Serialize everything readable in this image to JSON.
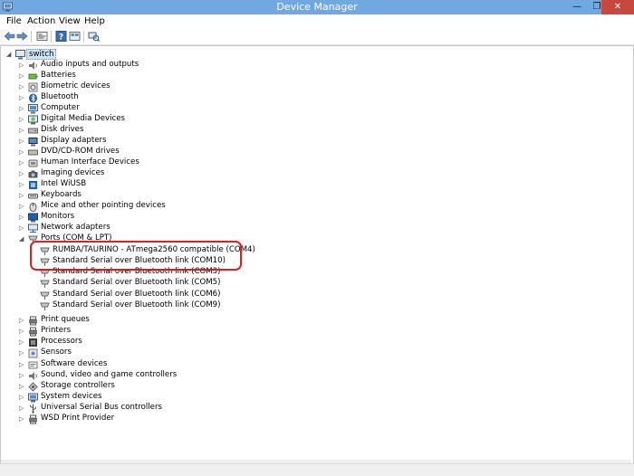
{
  "window": {
    "title": "Device Manager",
    "minimize_glyph": "—",
    "maximize_glyph": "❐",
    "close_glyph": "✕"
  },
  "menu": [
    "File",
    "Action",
    "View",
    "Help"
  ],
  "toolbar_icons": [
    "back-arrow-icon",
    "forward-arrow-icon",
    "properties-icon",
    "help-icon",
    "view-icon",
    "scan-hardware-icon"
  ],
  "tree": {
    "root": "switch",
    "categories_top": [
      {
        "label": "Audio inputs and outputs",
        "icon": "speaker-icon"
      },
      {
        "label": "Batteries",
        "icon": "battery-icon"
      },
      {
        "label": "Biometric devices",
        "icon": "biometric-icon"
      },
      {
        "label": "Bluetooth",
        "icon": "bluetooth-icon"
      },
      {
        "label": "Computer",
        "icon": "computer-icon"
      },
      {
        "label": "Digital Media Devices",
        "icon": "media-device-icon"
      },
      {
        "label": "Disk drives",
        "icon": "disk-drive-icon"
      },
      {
        "label": "Display adapters",
        "icon": "display-adapter-icon"
      },
      {
        "label": "DVD/CD-ROM drives",
        "icon": "dvd-drive-icon"
      },
      {
        "label": "Human Interface Devices",
        "icon": "hid-icon"
      },
      {
        "label": "Imaging devices",
        "icon": "camera-icon"
      },
      {
        "label": "Intel WiUSB",
        "icon": "wiusb-icon"
      },
      {
        "label": "Keyboards",
        "icon": "keyboard-icon"
      },
      {
        "label": "Mice and other pointing devices",
        "icon": "mouse-icon"
      },
      {
        "label": "Monitors",
        "icon": "monitor-icon"
      },
      {
        "label": "Network adapters",
        "icon": "network-adapter-icon"
      }
    ],
    "ports": {
      "label": "Ports (COM & LPT)",
      "children": [
        "RUMBA/TAURINO - ATmega2560 compatible (COM4)",
        "Standard Serial over Bluetooth link (COM10)",
        "Standard Serial over Bluetooth link (COM3)",
        "Standard Serial over Bluetooth link (COM5)",
        "Standard Serial over Bluetooth link (COM6)",
        "Standard Serial over Bluetooth link (COM9)"
      ]
    },
    "categories_bottom": [
      {
        "label": "Print queues",
        "icon": "print-queue-icon"
      },
      {
        "label": "Printers",
        "icon": "printer-icon"
      },
      {
        "label": "Processors",
        "icon": "processor-icon"
      },
      {
        "label": "Sensors",
        "icon": "sensor-icon"
      },
      {
        "label": "Software devices",
        "icon": "software-device-icon"
      },
      {
        "label": "Sound, video and game controllers",
        "icon": "sound-controller-icon"
      },
      {
        "label": "Storage controllers",
        "icon": "storage-controller-icon"
      },
      {
        "label": "System devices",
        "icon": "system-device-icon"
      },
      {
        "label": "Universal Serial Bus controllers",
        "icon": "usb-icon"
      },
      {
        "label": "WSD Print Provider",
        "icon": "wsd-printer-icon"
      }
    ]
  },
  "colors": {
    "titlebar": "#71a8e2",
    "close_button": "#c7483c",
    "highlight": "#d92121",
    "selection": "#cde4f7"
  }
}
